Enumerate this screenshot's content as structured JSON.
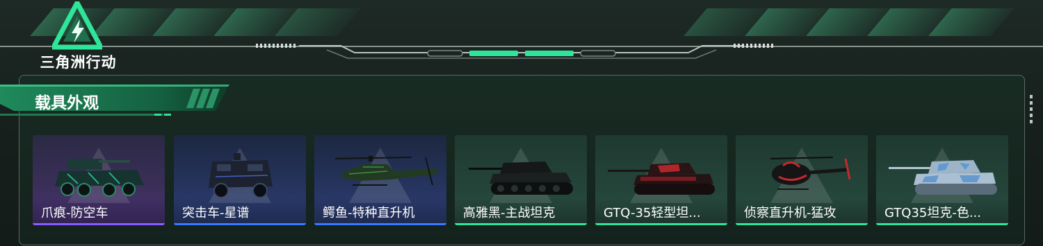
{
  "header": {
    "logo_text": "三角洲行动"
  },
  "panel": {
    "title": "载具外观"
  },
  "cards": [
    {
      "label": "爪痕-防空车",
      "rarity": "purple",
      "vehicle": "ifv-icon",
      "accent": "#8a5cff"
    },
    {
      "label": "突击车-星谱",
      "rarity": "blue",
      "vehicle": "armored-car-icon",
      "accent": "#3a78ff"
    },
    {
      "label": "鳄鱼-特种直升机",
      "rarity": "blue",
      "vehicle": "attack-helicopter-icon",
      "accent": "#3a78ff"
    },
    {
      "label": "高雅黑-主战坦克",
      "rarity": "green",
      "vehicle": "main-battle-tank-icon",
      "accent": "#2ee59a"
    },
    {
      "label": "GTQ-35轻型坦...",
      "rarity": "green",
      "vehicle": "light-tank-icon",
      "accent": "#2ee59a"
    },
    {
      "label": "侦察直升机-猛攻",
      "rarity": "green",
      "vehicle": "scout-helicopter-icon",
      "accent": "#2ee59a"
    },
    {
      "label": "GTQ35坦克-色...",
      "rarity": "green",
      "vehicle": "camo-tank-icon",
      "accent": "#2ee59a"
    }
  ]
}
